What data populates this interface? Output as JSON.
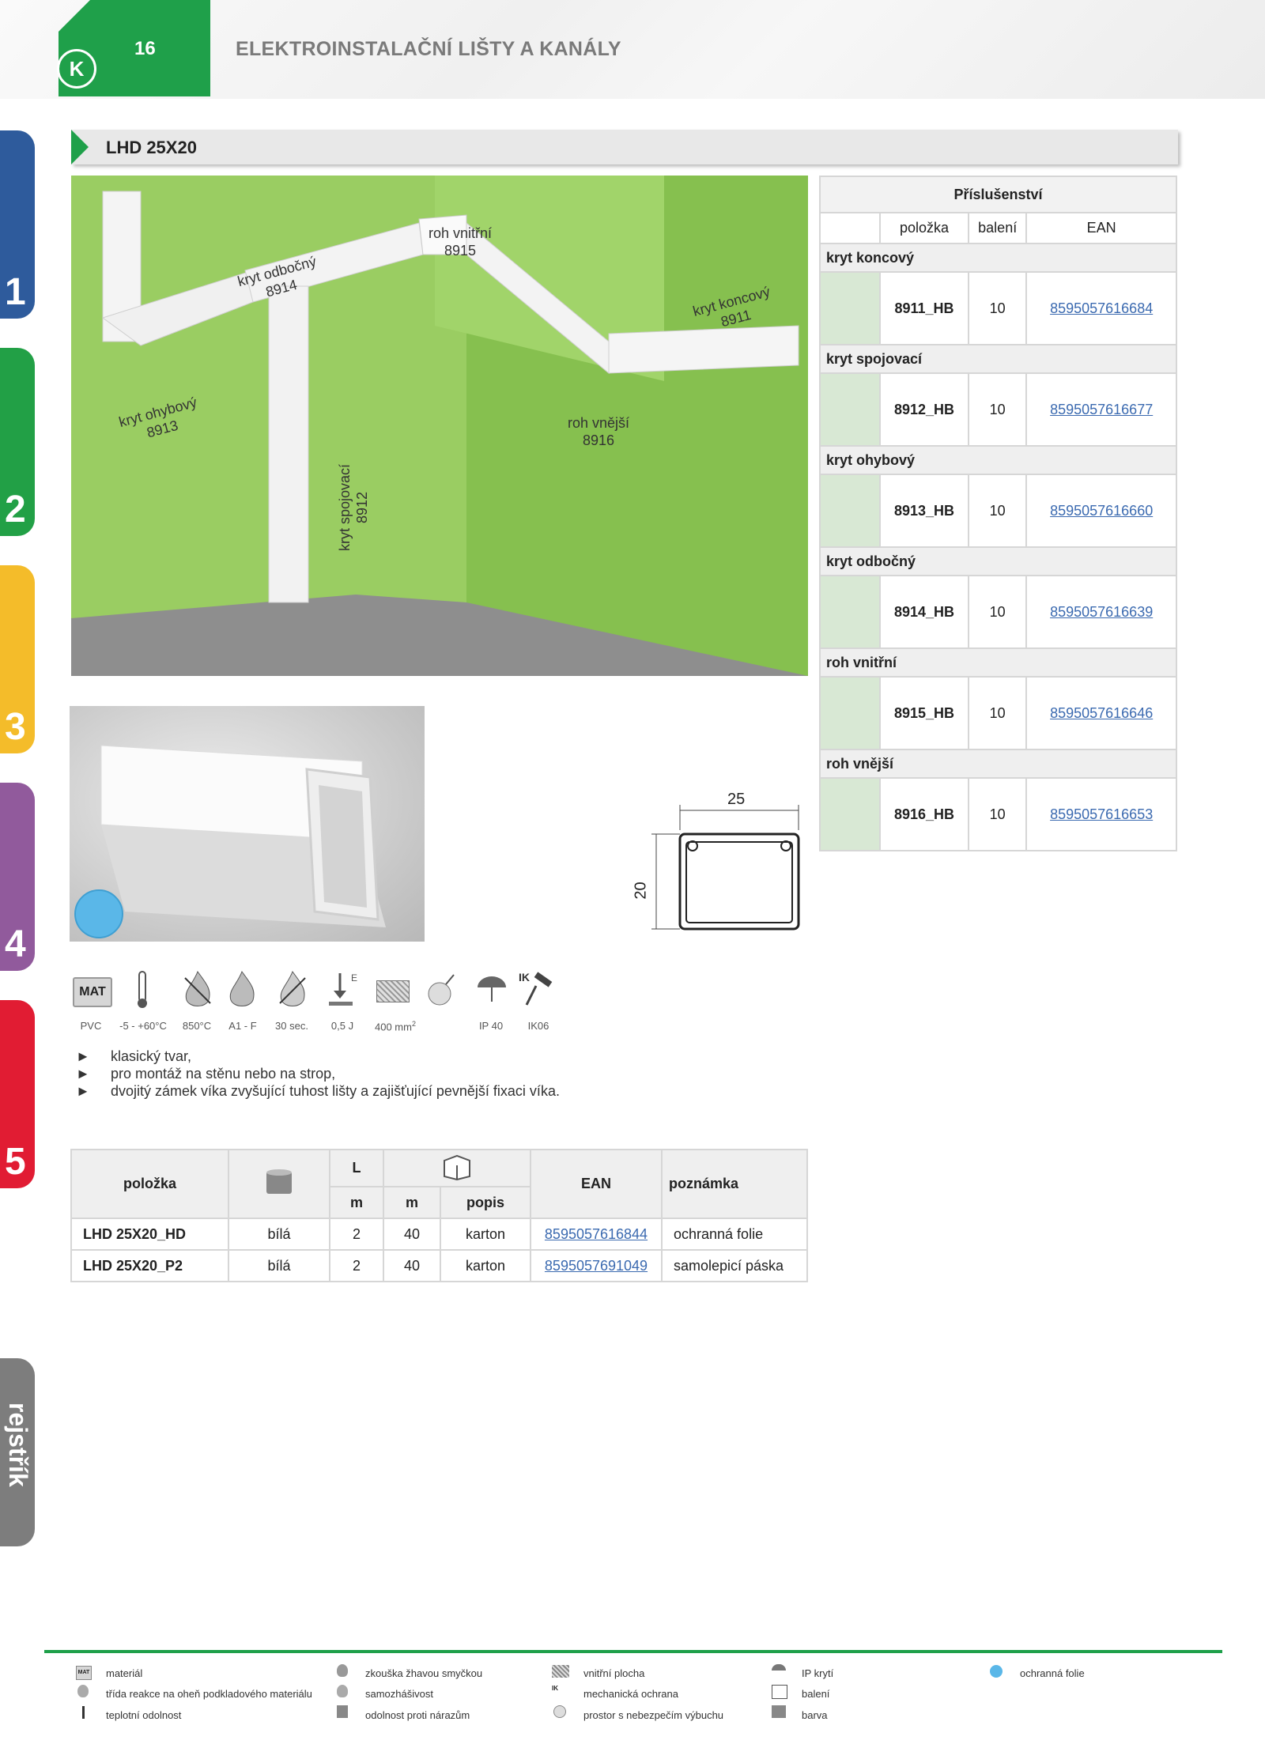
{
  "header": {
    "page_number": "16",
    "title": "ELEKTROINSTALAČNÍ LIŠTY A KANÁLY",
    "logo": "K"
  },
  "tabs": [
    "1",
    "2",
    "3",
    "4",
    "5",
    "rejstřík"
  ],
  "section": {
    "title": "LHD 25X20"
  },
  "room_labels": {
    "kryt_odbocny": [
      "kryt odbočný",
      "8914"
    ],
    "roh_vnitrni": [
      "roh vnitřní",
      "8915"
    ],
    "kryt_koncovy": [
      "kryt koncový",
      "8911"
    ],
    "kryt_ohybovy": [
      "kryt ohybový",
      "8913"
    ],
    "roh_vnejsi": [
      "roh vnější",
      "8916"
    ],
    "kryt_spojovaci": [
      "kryt spojovací",
      "8912"
    ]
  },
  "accessories": {
    "title": "Příslušenství",
    "columns": [
      "položka",
      "balení",
      "EAN"
    ],
    "rows": [
      {
        "category": "kryt koncový",
        "code": "8911_HB",
        "pack": "10",
        "ean": "8595057616684"
      },
      {
        "category": "kryt spojovací",
        "code": "8912_HB",
        "pack": "10",
        "ean": "8595057616677"
      },
      {
        "category": "kryt ohybový",
        "code": "8913_HB",
        "pack": "10",
        "ean": "8595057616660"
      },
      {
        "category": "kryt odbočný",
        "code": "8914_HB",
        "pack": "10",
        "ean": "8595057616639"
      },
      {
        "category": "roh vnitřní",
        "code": "8915_HB",
        "pack": "10",
        "ean": "8595057616646"
      },
      {
        "category": "roh vnější",
        "code": "8916_HB",
        "pack": "10",
        "ean": "8595057616653"
      }
    ]
  },
  "profile": {
    "width": "25",
    "height": "20"
  },
  "properties": {
    "mat_badge": "MAT",
    "ik_badge": "IK",
    "e_badge": "E",
    "labels": [
      "PVC",
      "-5 - +60°C",
      "850°C",
      "A1 - F",
      "30 sec.",
      "0,5 J",
      "400 mm",
      "IP 40",
      "IK06"
    ],
    "area_superscript": "2"
  },
  "bullets": [
    "klasický tvar,",
    "pro montáž na stěnu nebo na strop,",
    "dvojitý zámek víka zvyšující tuhost lišty a zajišťující pevnější fixaci víka."
  ],
  "bullet_marker": "►",
  "main_table": {
    "headers": {
      "item": "položka",
      "length": "L",
      "ean": "EAN",
      "note": "poznámka"
    },
    "subheaders": {
      "length_unit": "m",
      "pack_unit": "m",
      "pack_desc": "popis"
    },
    "rows": [
      {
        "item": "LHD 25X20_HD",
        "color": "bílá",
        "length": "2",
        "pack": "40",
        "pack_type": "karton",
        "ean": "8595057616844",
        "note": "ochranná folie"
      },
      {
        "item": "LHD 25X20_P2",
        "color": "bílá",
        "length": "2",
        "pack": "40",
        "pack_type": "karton",
        "ean": "8595057691049",
        "note": "samolepicí páska"
      }
    ]
  },
  "legend": {
    "col1": [
      "materiál",
      "třída reakce na oheň podkladového materiálu",
      "teplotní odolnost"
    ],
    "col2": [
      "zkouška žhavou smyčkou",
      "samozhášivost",
      "odolnost proti nárazům"
    ],
    "col3": [
      "vnitřní plocha",
      "mechanická ochrana",
      "prostor s nebezpečím výbuchu"
    ],
    "col4": [
      "IP krytí",
      "balení",
      "barva"
    ],
    "col5": [
      "ochranná folie"
    ]
  },
  "colors": {
    "accent_green": "#1fa04a",
    "wall_green": "#8fc95a",
    "link_blue": "#3b6ab0"
  }
}
